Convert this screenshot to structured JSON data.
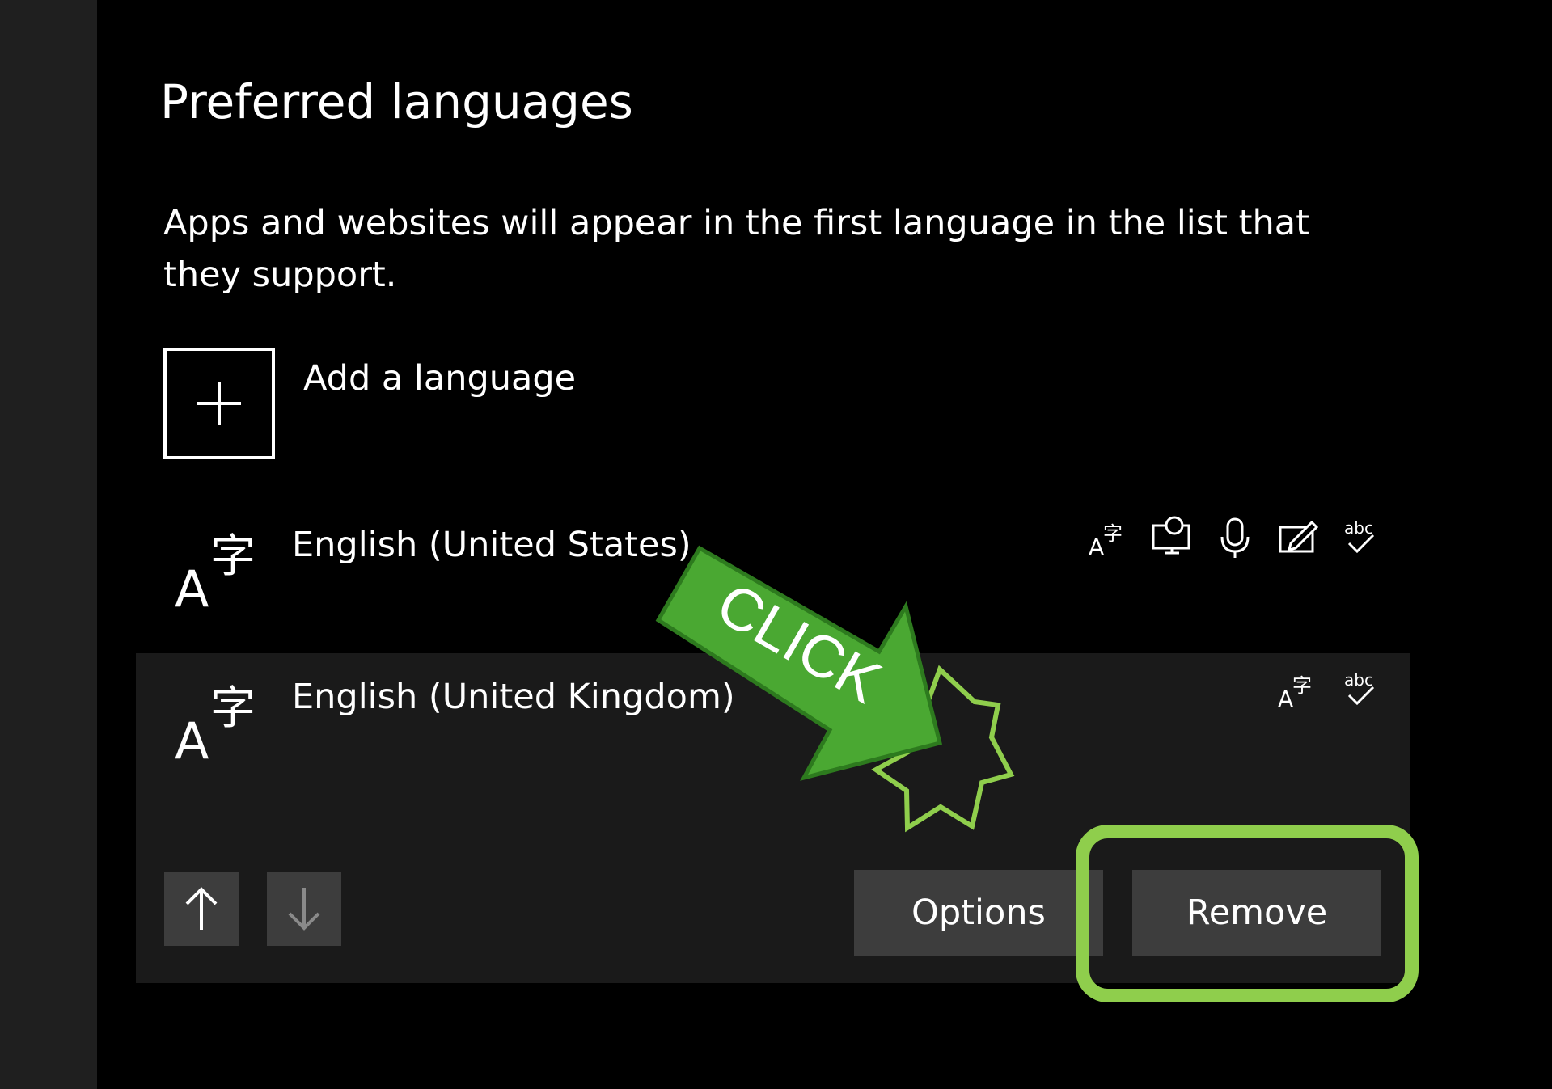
{
  "page": {
    "title": "Preferred languages",
    "description": "Apps and websites will appear in the first language in the list that they support."
  },
  "add_language": {
    "label": "Add a language"
  },
  "languages": [
    {
      "name": "English (United States)",
      "features": [
        "display-language-icon",
        "text-to-speech-icon",
        "speech-recognition-icon",
        "handwriting-icon",
        "spellcheck-icon"
      ]
    },
    {
      "name": "English (United Kingdom)",
      "selected": true,
      "features": [
        "display-language-icon",
        "spellcheck-icon"
      ],
      "buttons": {
        "options": "Options",
        "remove": "Remove"
      }
    }
  ],
  "annotation": {
    "arrow_text": "CLICK",
    "arrow_color": "#4aa832",
    "highlight_color": "#8fce4c"
  },
  "colors": {
    "background": "#000000",
    "sidebar": "#1f1f1f",
    "selected_row": "#1a1a1a",
    "button": "#3d3d3d"
  }
}
